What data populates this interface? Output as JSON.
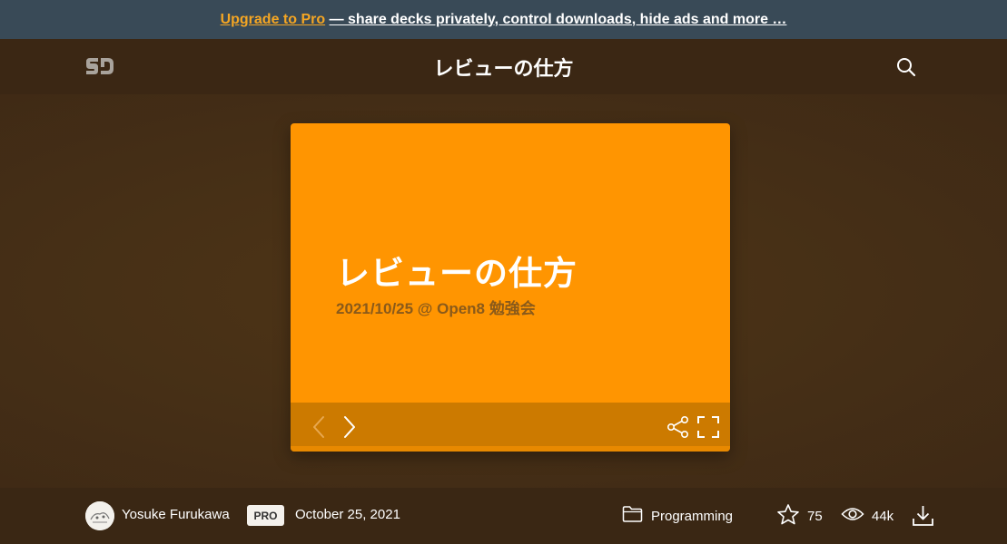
{
  "promo": {
    "link_label": "Upgrade to Pro",
    "text": "— share decks privately, control downloads, hide ads and more …"
  },
  "header": {
    "logo": "SD",
    "title": "レビューの仕方",
    "search_icon": "search-icon"
  },
  "slide": {
    "title": "レビューの仕方",
    "subtitle": "2021/10/25 @ Open8 勉強会",
    "background": "#ff9501",
    "controls": [
      "prev-icon",
      "next-icon",
      "share-icon",
      "fullscreen-icon"
    ]
  },
  "footer": {
    "author": "Yosuke Furukawa",
    "badge": "PRO",
    "date": "October 25, 2021",
    "category": "Programming",
    "stars": "75",
    "views": "44k",
    "icons": [
      "folder-icon",
      "star-icon",
      "eye-icon",
      "download-icon"
    ]
  },
  "colors": {
    "promo_bg": "#394a57",
    "accent": "#f5a623",
    "page_bg": "#3d2815",
    "slide_bg": "#ff9501"
  }
}
